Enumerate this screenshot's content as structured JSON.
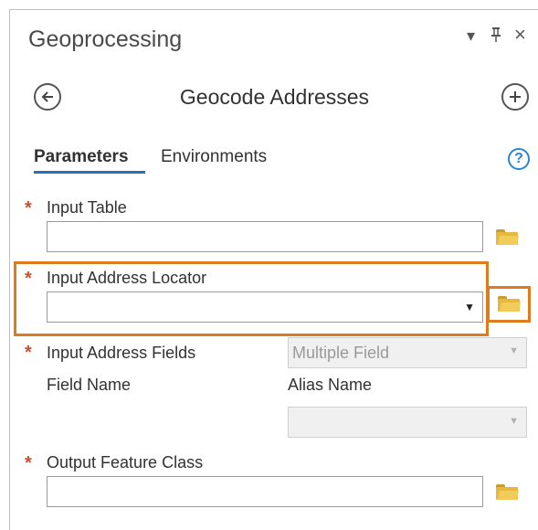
{
  "pane": {
    "title": "Geoprocessing",
    "controls": {
      "dropdown": "▾",
      "pin": "⊥",
      "close": "×"
    }
  },
  "tool": {
    "title": "Geocode Addresses",
    "back_icon": "back-arrow-icon",
    "add_icon": "plus-icon"
  },
  "tabs": [
    {
      "label": "Parameters",
      "active": true
    },
    {
      "label": "Environments",
      "active": false
    }
  ],
  "help": {
    "label": "?"
  },
  "required_marker": "*",
  "params": {
    "input_table": {
      "label": "Input Table",
      "value": ""
    },
    "address_locator": {
      "label": "Input Address Locator",
      "value": "",
      "arrow": "▼"
    },
    "address_fields": {
      "label": "Input Address Fields",
      "selected": "Multiple Field"
    },
    "field_name_header": "Field Name",
    "alias_name_header": "Alias Name",
    "alias_value": "",
    "output_feature_class": {
      "label": "Output Feature Class",
      "value": ""
    }
  },
  "colors": {
    "accent_blue": "#2a6fb5",
    "required_red": "#c8502e",
    "highlight_orange": "#e07a1f",
    "folder_yellow": "#e6b83e"
  }
}
